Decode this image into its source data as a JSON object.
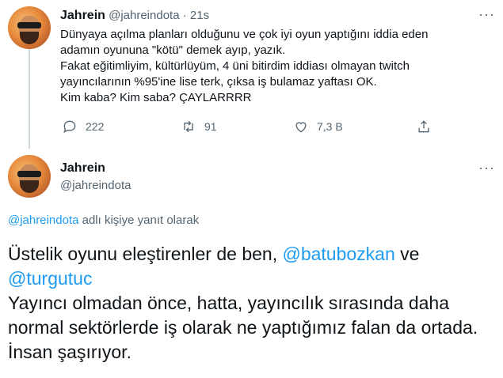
{
  "tweet1": {
    "name": "Jahrein",
    "handle": "@jahreindota",
    "separator": "·",
    "time": "21s",
    "text": "Dünyaya açılma planları olduğunu ve çok iyi oyun yaptığını iddia eden\nadamın oyununa \"kötü\" demek ayıp, yazık.\nFakat eğitimliyim, kültürlüyüm, 4 üni bitirdim iddiası olmayan twitch\nyayıncılarının %95'ine lise terk, çıksa iş bulamaz yaftası OK.\nKim kaba? Kim saba? ÇAYLARRRR",
    "actions": {
      "replies": "222",
      "retweets": "91",
      "likes": "7,3 B"
    },
    "more_label": "···"
  },
  "tweet2": {
    "name": "Jahrein",
    "handle": "@jahreindota",
    "more_label": "···",
    "reply_to_handle": "@jahreindota",
    "reply_to_suffix": " adlı kişiye yanıt olarak",
    "line1_a": "Üstelik oyunu eleştirenler de ben, ",
    "mention1": "@batubozkan",
    "line1_b": " ve",
    "mention2": "@turgutuc",
    "line3": "Yayıncı olmadan önce, hatta, yayıncılık sırasında daha",
    "line4": "normal sektörlerde iş olarak ne yaptığımız falan da ortada.",
    "line5": "İnsan şaşırıyor."
  },
  "icons": [
    "avatar",
    "reply-icon",
    "retweet-icon",
    "like-icon",
    "share-icon",
    "more-icon"
  ]
}
